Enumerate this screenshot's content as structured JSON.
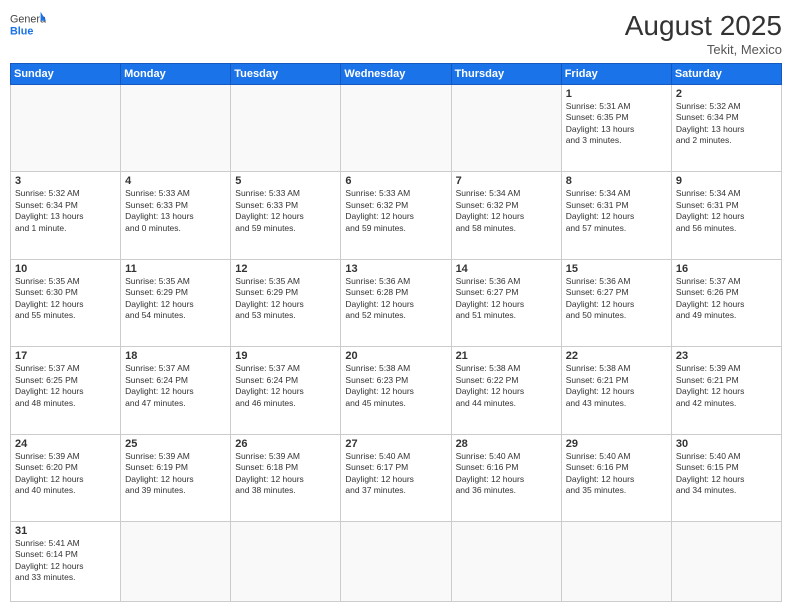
{
  "header": {
    "logo_general": "General",
    "logo_blue": "Blue",
    "month_year": "August 2025",
    "location": "Tekit, Mexico"
  },
  "weekdays": [
    "Sunday",
    "Monday",
    "Tuesday",
    "Wednesday",
    "Thursday",
    "Friday",
    "Saturday"
  ],
  "weeks": [
    [
      {
        "day": "",
        "info": ""
      },
      {
        "day": "",
        "info": ""
      },
      {
        "day": "",
        "info": ""
      },
      {
        "day": "",
        "info": ""
      },
      {
        "day": "",
        "info": ""
      },
      {
        "day": "1",
        "info": "Sunrise: 5:31 AM\nSunset: 6:35 PM\nDaylight: 13 hours\nand 3 minutes."
      },
      {
        "day": "2",
        "info": "Sunrise: 5:32 AM\nSunset: 6:34 PM\nDaylight: 13 hours\nand 2 minutes."
      }
    ],
    [
      {
        "day": "3",
        "info": "Sunrise: 5:32 AM\nSunset: 6:34 PM\nDaylight: 13 hours\nand 1 minute."
      },
      {
        "day": "4",
        "info": "Sunrise: 5:33 AM\nSunset: 6:33 PM\nDaylight: 13 hours\nand 0 minutes."
      },
      {
        "day": "5",
        "info": "Sunrise: 5:33 AM\nSunset: 6:33 PM\nDaylight: 12 hours\nand 59 minutes."
      },
      {
        "day": "6",
        "info": "Sunrise: 5:33 AM\nSunset: 6:32 PM\nDaylight: 12 hours\nand 59 minutes."
      },
      {
        "day": "7",
        "info": "Sunrise: 5:34 AM\nSunset: 6:32 PM\nDaylight: 12 hours\nand 58 minutes."
      },
      {
        "day": "8",
        "info": "Sunrise: 5:34 AM\nSunset: 6:31 PM\nDaylight: 12 hours\nand 57 minutes."
      },
      {
        "day": "9",
        "info": "Sunrise: 5:34 AM\nSunset: 6:31 PM\nDaylight: 12 hours\nand 56 minutes."
      }
    ],
    [
      {
        "day": "10",
        "info": "Sunrise: 5:35 AM\nSunset: 6:30 PM\nDaylight: 12 hours\nand 55 minutes."
      },
      {
        "day": "11",
        "info": "Sunrise: 5:35 AM\nSunset: 6:29 PM\nDaylight: 12 hours\nand 54 minutes."
      },
      {
        "day": "12",
        "info": "Sunrise: 5:35 AM\nSunset: 6:29 PM\nDaylight: 12 hours\nand 53 minutes."
      },
      {
        "day": "13",
        "info": "Sunrise: 5:36 AM\nSunset: 6:28 PM\nDaylight: 12 hours\nand 52 minutes."
      },
      {
        "day": "14",
        "info": "Sunrise: 5:36 AM\nSunset: 6:27 PM\nDaylight: 12 hours\nand 51 minutes."
      },
      {
        "day": "15",
        "info": "Sunrise: 5:36 AM\nSunset: 6:27 PM\nDaylight: 12 hours\nand 50 minutes."
      },
      {
        "day": "16",
        "info": "Sunrise: 5:37 AM\nSunset: 6:26 PM\nDaylight: 12 hours\nand 49 minutes."
      }
    ],
    [
      {
        "day": "17",
        "info": "Sunrise: 5:37 AM\nSunset: 6:25 PM\nDaylight: 12 hours\nand 48 minutes."
      },
      {
        "day": "18",
        "info": "Sunrise: 5:37 AM\nSunset: 6:24 PM\nDaylight: 12 hours\nand 47 minutes."
      },
      {
        "day": "19",
        "info": "Sunrise: 5:37 AM\nSunset: 6:24 PM\nDaylight: 12 hours\nand 46 minutes."
      },
      {
        "day": "20",
        "info": "Sunrise: 5:38 AM\nSunset: 6:23 PM\nDaylight: 12 hours\nand 45 minutes."
      },
      {
        "day": "21",
        "info": "Sunrise: 5:38 AM\nSunset: 6:22 PM\nDaylight: 12 hours\nand 44 minutes."
      },
      {
        "day": "22",
        "info": "Sunrise: 5:38 AM\nSunset: 6:21 PM\nDaylight: 12 hours\nand 43 minutes."
      },
      {
        "day": "23",
        "info": "Sunrise: 5:39 AM\nSunset: 6:21 PM\nDaylight: 12 hours\nand 42 minutes."
      }
    ],
    [
      {
        "day": "24",
        "info": "Sunrise: 5:39 AM\nSunset: 6:20 PM\nDaylight: 12 hours\nand 40 minutes."
      },
      {
        "day": "25",
        "info": "Sunrise: 5:39 AM\nSunset: 6:19 PM\nDaylight: 12 hours\nand 39 minutes."
      },
      {
        "day": "26",
        "info": "Sunrise: 5:39 AM\nSunset: 6:18 PM\nDaylight: 12 hours\nand 38 minutes."
      },
      {
        "day": "27",
        "info": "Sunrise: 5:40 AM\nSunset: 6:17 PM\nDaylight: 12 hours\nand 37 minutes."
      },
      {
        "day": "28",
        "info": "Sunrise: 5:40 AM\nSunset: 6:16 PM\nDaylight: 12 hours\nand 36 minutes."
      },
      {
        "day": "29",
        "info": "Sunrise: 5:40 AM\nSunset: 6:16 PM\nDaylight: 12 hours\nand 35 minutes."
      },
      {
        "day": "30",
        "info": "Sunrise: 5:40 AM\nSunset: 6:15 PM\nDaylight: 12 hours\nand 34 minutes."
      }
    ],
    [
      {
        "day": "31",
        "info": "Sunrise: 5:41 AM\nSunset: 6:14 PM\nDaylight: 12 hours\nand 33 minutes."
      },
      {
        "day": "",
        "info": ""
      },
      {
        "day": "",
        "info": ""
      },
      {
        "day": "",
        "info": ""
      },
      {
        "day": "",
        "info": ""
      },
      {
        "day": "",
        "info": ""
      },
      {
        "day": "",
        "info": ""
      }
    ]
  ]
}
